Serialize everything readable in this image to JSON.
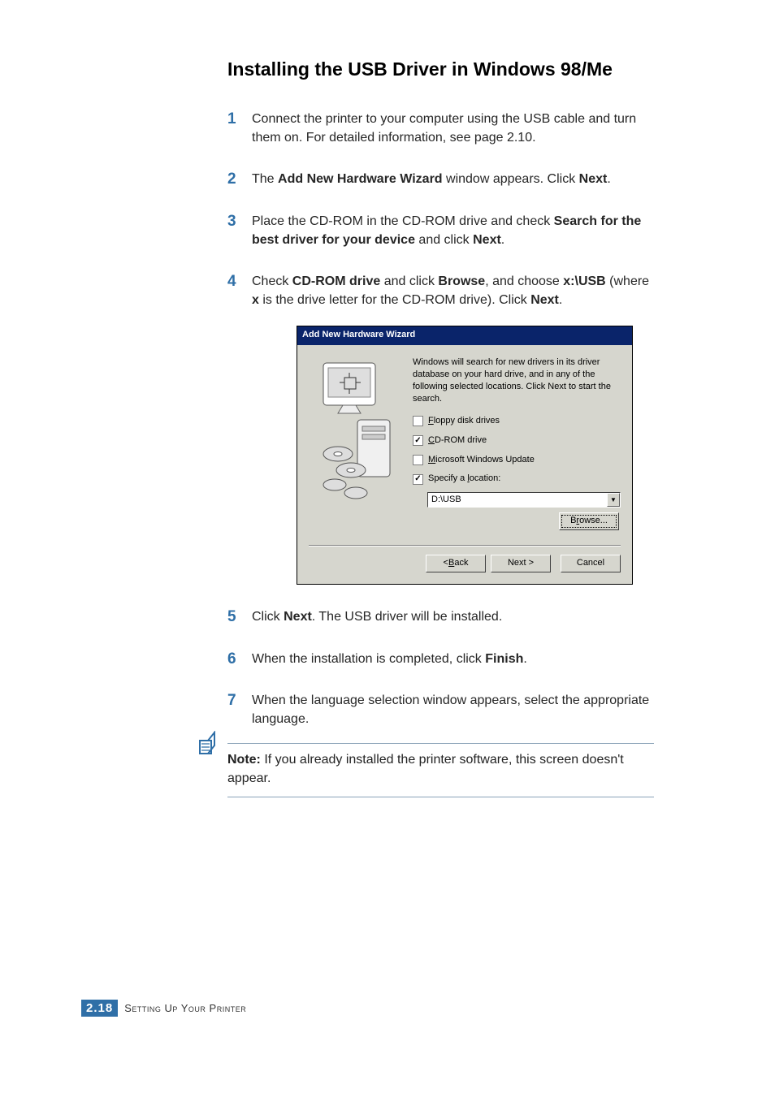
{
  "heading": "Installing the USB Driver in Windows 98/Me",
  "steps": {
    "s1": {
      "num": "1",
      "pre": "Connect the printer to your computer using the USB cable and turn them on. For detailed information, see ",
      "link": "page 2.10",
      "post": "."
    },
    "s2": {
      "num": "2",
      "t0": "The ",
      "b1": "Add New Hardware Wizard",
      "t2": " window appears. Click ",
      "b3": "Next",
      "t4": "."
    },
    "s3": {
      "num": "3",
      "t0": "Place the CD-ROM in the CD-ROM drive and check ",
      "b1": "Search for the best driver for your device",
      "t2": " and click ",
      "b3": "Next",
      "t4": "."
    },
    "s4": {
      "num": "4",
      "t0": "Check ",
      "b1": "CD-ROM drive",
      "t2": " and click ",
      "b3": "Browse",
      "t4": ", and choose ",
      "b5": "x:\\USB",
      "t6": " (where ",
      "b7": "x",
      "t8": " is the drive letter for the CD-ROM drive). Click ",
      "b9": "Next",
      "t10": "."
    },
    "s5": {
      "num": "5",
      "t0": "Click ",
      "b1": "Next",
      "t2": ". The USB driver will be installed."
    },
    "s6": {
      "num": "6",
      "t0": "When the installation is completed, click ",
      "b1": "Finish",
      "t2": "."
    },
    "s7": {
      "num": "7",
      "text": "When the language selection window appears, select the appropriate language."
    }
  },
  "dialog": {
    "title": "Add New Hardware Wizard",
    "desc": "Windows will search for new drivers in its driver database on your hard drive, and in any of the following selected locations. Click Next to start the search.",
    "floppy": {
      "label_pre": "F",
      "label_rest": "loppy disk drives"
    },
    "cdrom": {
      "label_pre": "C",
      "label_rest": "D-ROM drive"
    },
    "msupd": {
      "label_pre": "M",
      "label_rest": "icrosoft Windows Update"
    },
    "spec": {
      "label_pre": "Specify a ",
      "label_u": "l",
      "label_rest": "ocation:"
    },
    "location_value": "D:\\USB",
    "browse": {
      "pre": "B",
      "u": "r",
      "rest": "owse..."
    },
    "back": {
      "lt": "< ",
      "u": "B",
      "rest": "ack"
    },
    "next": "Next >",
    "cancel": "Cancel"
  },
  "note": {
    "label": "Note:",
    "text": " If you already installed the printer software, this screen doesn't appear."
  },
  "footer": {
    "chapter": "2.",
    "page": "18",
    "section": "Setting Up Your Printer"
  }
}
